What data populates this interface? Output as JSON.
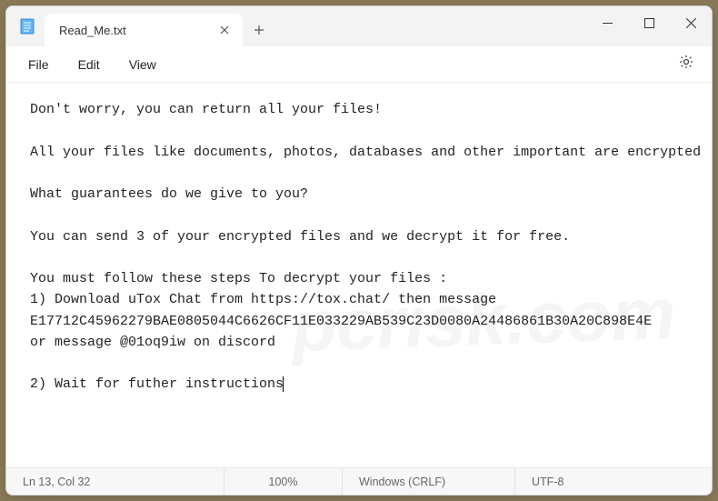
{
  "window": {
    "tab_title": "Read_Me.txt"
  },
  "menu": {
    "file": "File",
    "edit": "Edit",
    "view": "View"
  },
  "content": {
    "line1": "Don't worry, you can return all your files!",
    "line2": "All your files like documents, photos, databases and other important are encrypted",
    "line3": "What guarantees do we give to you?",
    "line4": "You can send 3 of your encrypted files and we decrypt it for free.",
    "line5": "You must follow these steps To decrypt your files :",
    "line6": "1) Download uTox Chat from https://tox.chat/ then message E17712C45962279BAE0805044C6626CF11E033229AB539C23D0080A24486861B30A20C898E4E",
    "line7": "or message @01oq9iw on discord",
    "line8": "2) Wait for futher instructions"
  },
  "status": {
    "position": "Ln 13, Col 32",
    "zoom": "100%",
    "line_ending": "Windows (CRLF)",
    "encoding": "UTF-8"
  }
}
